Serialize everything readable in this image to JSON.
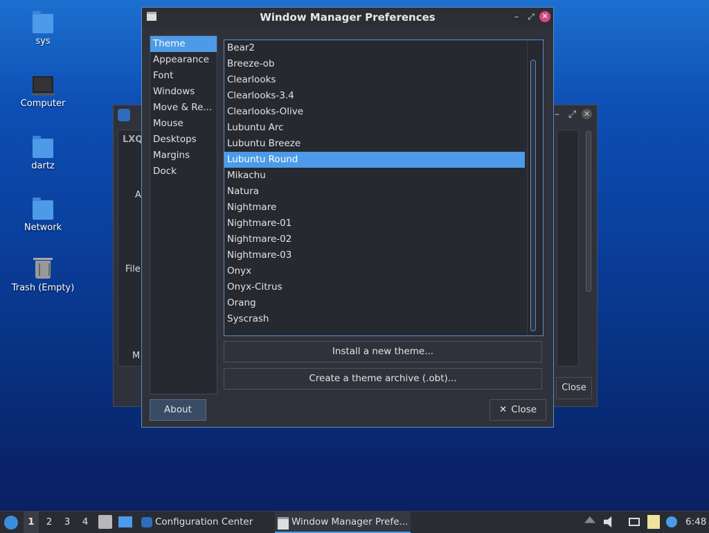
{
  "desktop": {
    "icons": [
      {
        "label": "sys"
      },
      {
        "label": "Computer"
      },
      {
        "label": "dartz"
      },
      {
        "label": "Network"
      },
      {
        "label": "Trash (Empty)"
      }
    ]
  },
  "background_window": {
    "title_fragment": "LXQ",
    "labels": [
      "A",
      "File",
      "M"
    ],
    "close_label": "Close"
  },
  "window": {
    "title": "Window Manager Preferences",
    "controls": {
      "minimize": "–",
      "maximize": "⤢",
      "close": "✕"
    },
    "sidebar": {
      "items": [
        {
          "label": "Theme",
          "selected": true
        },
        {
          "label": "Appearance"
        },
        {
          "label": "Font"
        },
        {
          "label": "Windows"
        },
        {
          "label": "Move & Re..."
        },
        {
          "label": "Mouse"
        },
        {
          "label": "Desktops"
        },
        {
          "label": "Margins"
        },
        {
          "label": "Dock"
        }
      ]
    },
    "themes": {
      "selected": "Lubuntu Round",
      "items": [
        "Bear2",
        "Breeze-ob",
        "Clearlooks",
        "Clearlooks-3.4",
        "Clearlooks-Olive",
        "Lubuntu Arc",
        "Lubuntu Breeze",
        "Lubuntu Round",
        "Mikachu",
        "Natura",
        "Nightmare",
        "Nightmare-01",
        "Nightmare-02",
        "Nightmare-03",
        "Onyx",
        "Onyx-Citrus",
        "Orang",
        "Syscrash"
      ]
    },
    "buttons": {
      "install": "Install a new theme...",
      "archive": "Create a theme archive (.obt)...",
      "about": "About",
      "close": "Close",
      "close_icon": "✕"
    }
  },
  "taskbar": {
    "workspaces": [
      "1",
      "2",
      "3",
      "4"
    ],
    "active_workspace": "1",
    "tasks": [
      {
        "label": "Configuration Center"
      },
      {
        "label": "Window Manager Prefe..."
      }
    ],
    "clock": "6:48"
  },
  "colors": {
    "accent": "#4d9be8",
    "window_bg": "#2f323a",
    "list_bg": "#262930"
  }
}
